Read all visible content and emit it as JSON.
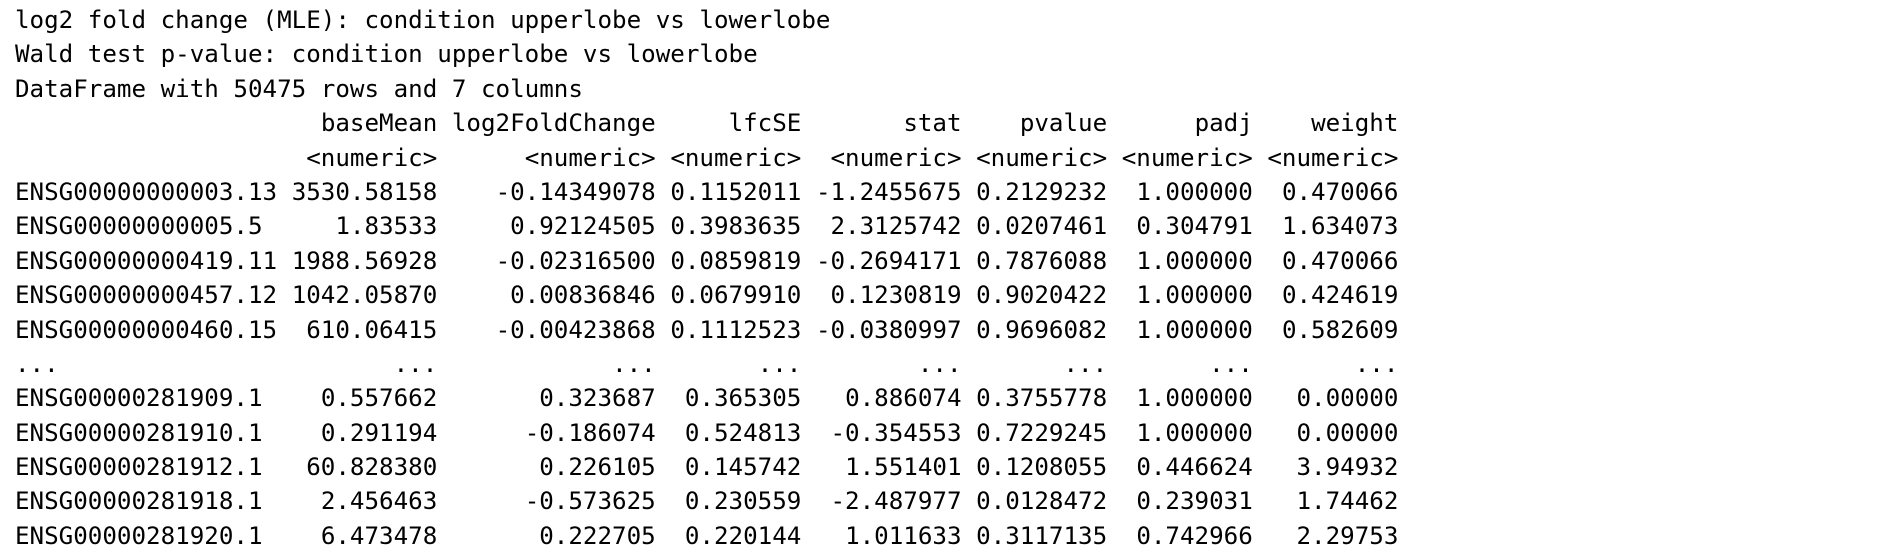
{
  "console": {
    "header_lines": [
      "log2 fold change (MLE): condition upperlobe vs lowerlobe",
      "Wald test p-value: condition upperlobe vs lowerlobe",
      "DataFrame with 50475 rows and 7 columns"
    ],
    "table": {
      "columns": [
        "baseMean",
        "log2FoldChange",
        "lfcSE",
        "stat",
        "pvalue",
        "padj",
        "weight"
      ],
      "column_types": [
        "<numeric>",
        "<numeric>",
        "<numeric>",
        "<numeric>",
        "<numeric>",
        "<numeric>",
        "<numeric>"
      ],
      "rows": [
        [
          "ENSG00000000003.13",
          "3530.58158",
          "-0.14349078",
          "0.1152011",
          "-1.2455675",
          "0.2129232",
          "1.000000",
          "0.470066"
        ],
        [
          "ENSG00000000005.5",
          "1.83533",
          "0.92124505",
          "0.3983635",
          "2.3125742",
          "0.0207461",
          "0.304791",
          "1.634073"
        ],
        [
          "ENSG00000000419.11",
          "1988.56928",
          "-0.02316500",
          "0.0859819",
          "-0.2694171",
          "0.7876088",
          "1.000000",
          "0.470066"
        ],
        [
          "ENSG00000000457.12",
          "1042.05870",
          "0.00836846",
          "0.0679910",
          "0.1230819",
          "0.9020422",
          "1.000000",
          "0.424619"
        ],
        [
          "ENSG00000000460.15",
          "610.06415",
          "-0.00423868",
          "0.1112523",
          "-0.0380997",
          "0.9696082",
          "1.000000",
          "0.582609"
        ],
        [
          "...",
          "...",
          "...",
          "...",
          "...",
          "...",
          "...",
          "..."
        ],
        [
          "ENSG00000281909.1",
          "0.557662",
          "0.323687",
          "0.365305",
          "0.886074",
          "0.3755778",
          "1.000000",
          "0.00000"
        ],
        [
          "ENSG00000281910.1",
          "0.291194",
          "-0.186074",
          "0.524813",
          "-0.354553",
          "0.7229245",
          "1.000000",
          "0.00000"
        ],
        [
          "ENSG00000281912.1",
          "60.828380",
          "0.226105",
          "0.145742",
          "1.551401",
          "0.1208055",
          "0.446624",
          "3.94932"
        ],
        [
          "ENSG00000281918.1",
          "2.456463",
          "-0.573625",
          "0.230559",
          "-2.487977",
          "0.0128472",
          "0.239031",
          "1.74462"
        ],
        [
          "ENSG00000281920.1",
          "6.473478",
          "0.222705",
          "0.220144",
          "1.011633",
          "0.3117135",
          "0.742966",
          "2.29753"
        ]
      ]
    }
  }
}
